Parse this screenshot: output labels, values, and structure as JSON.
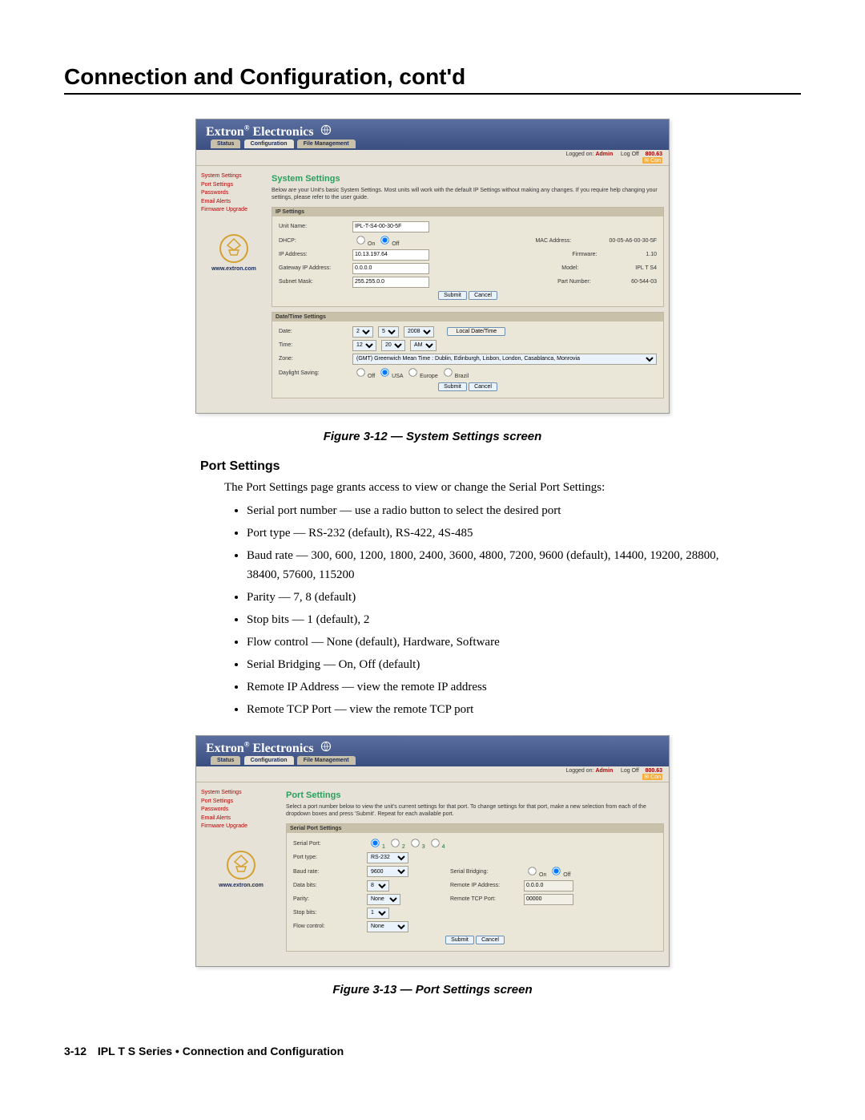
{
  "title": "Connection and Configuration, cont'd",
  "fig12_caption": "Figure 3-12 — System Settings screen",
  "fig13_caption": "Figure 3-13 — Port Settings screen",
  "port_settings_head": "Port Settings",
  "port_settings_intro": "The Port Settings page grants access to view or change the Serial Port Settings:",
  "bullets": [
    "Serial port number — use a radio button to select the desired port",
    "Port type — RS-232 (default), RS-422, 4S-485",
    "Baud rate — 300, 600, 1200, 1800, 2400, 3600, 4800, 7200, 9600 (default), 14400, 19200, 28800, 38400, 57600, 115200",
    "Parity — 7, 8 (default)",
    "Stop bits — 1 (default), 2",
    "Flow control  — None (default), Hardware, Software",
    "Serial Bridging — On, Off (default)",
    "Remote IP Address — view the remote IP address",
    "Remote TCP Port — view the remote TCP port"
  ],
  "brand": "Extron",
  "brand2": "Electronics",
  "tabs": [
    "Status",
    "Configuration",
    "File Management"
  ],
  "infobar": {
    "logged": "Logged on:",
    "admin": "Admin",
    "logoff": "Log Off",
    "phone": "800.63"
  },
  "sidebar": {
    "items": [
      "System Settings",
      "Port Settings",
      "Passwords",
      "Email Alerts",
      "Firmware Upgrade"
    ],
    "url": "www.extron.com"
  },
  "sys": {
    "title": "System Settings",
    "blurb": "Below are your Unit's basic System Settings. Most units will work with the default IP Settings without making any changes. If you require help changing your settings, please refer to the user guide.",
    "ip_panel": "IP Settings",
    "unit_name_label": "Unit Name:",
    "unit_name": "IPL-T-S4-00-30-5F",
    "dhcp_label": "DHCP:",
    "dhcp_on": "On",
    "dhcp_off": "Off",
    "ip_label": "IP Address:",
    "ip": "10.13.197.64",
    "gw_label": "Gateway IP Address:",
    "gw": "0.0.0.0",
    "sm_label": "Subnet Mask:",
    "sm": "255.255.0.0",
    "mac_label": "MAC Address:",
    "mac": "00-05-A6-00-30-5F",
    "fw_label": "Firmware:",
    "fw": "1.10",
    "model_label": "Model:",
    "model": "IPL T S4",
    "pn_label": "Part Number:",
    "pn": "60-544-03",
    "dt_panel": "Date/Time Settings",
    "date_label": "Date:",
    "date_m": "2",
    "date_d": "5",
    "date_y": "2008",
    "local_btn": "Local Date/Time",
    "time_label": "Time:",
    "time_h": "12",
    "time_m": "20",
    "time_ap": "AM",
    "zone_label": "Zone:",
    "zone": "(GMT) Greenwich Mean Time : Dublin, Edinburgh, Lisbon, London, Casablanca, Monrovia",
    "ds_label": "Daylight Saving:",
    "ds_off": "Off",
    "ds_usa": "USA",
    "ds_eu": "Europe",
    "ds_br": "Brazil",
    "submit": "Submit",
    "cancel": "Cancel"
  },
  "port": {
    "title": "Port Settings",
    "blurb": "Select a port number below to view the unit's current settings for that port. To change settings for that port, make a new selection from each of the dropdown boxes and press 'Submit'. Repeat for each available port.",
    "panel": "Serial Port Settings",
    "serial_port_label": "Serial Port:",
    "p1": "1",
    "p2": "2",
    "p3": "3",
    "p4": "4",
    "port_type_label": "Port type:",
    "port_type": "RS-232",
    "baud_label": "Baud rate:",
    "baud": "9600",
    "data_bits_label": "Data bits:",
    "data_bits": "8",
    "parity_label": "Parity:",
    "parity": "None",
    "stop_bits_label": "Stop bits:",
    "stop_bits": "1",
    "flow_label": "Flow control:",
    "flow": "None",
    "sb_label": "Serial Bridging:",
    "sb_on": "On",
    "sb_off": "Off",
    "rip_label": "Remote IP Address:",
    "rip": "0.0.0.0",
    "rtcp_label": "Remote TCP Port:",
    "rtcp": "00000"
  },
  "footer": {
    "pagenum": "3-12",
    "text": "IPL T S Series • Connection and Configuration"
  }
}
